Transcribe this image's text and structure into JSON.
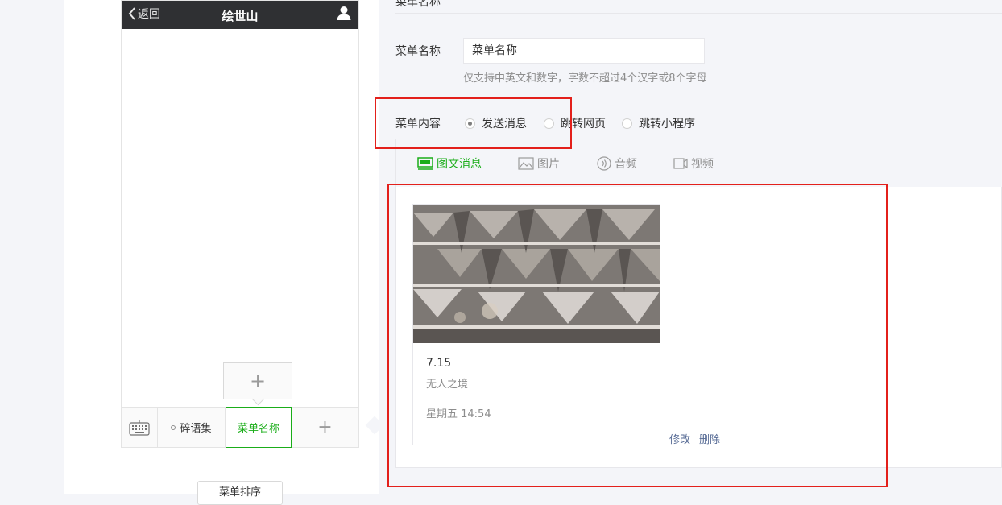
{
  "phone": {
    "back_label": "返回",
    "title": "绘世山",
    "submenu_add": "+",
    "menu": [
      {
        "label": "碎语集"
      },
      {
        "label": "菜单名称"
      },
      {
        "label": "+"
      }
    ]
  },
  "sort_button": "菜单排序",
  "editor": {
    "title": "菜单名称",
    "name_label": "菜单名称",
    "name_value": "菜单名称",
    "name_tip": "仅支持中英文和数字，字数不超过4个汉字或8个字母",
    "content_label": "菜单内容",
    "radios": [
      {
        "label": "发送消息",
        "checked": true
      },
      {
        "label": "跳转网页",
        "checked": false
      },
      {
        "label": "跳转小程序",
        "checked": false
      }
    ],
    "tabs": [
      {
        "label": "图文消息",
        "icon": "news-icon",
        "active": true
      },
      {
        "label": "图片",
        "icon": "image-icon",
        "active": false
      },
      {
        "label": "音频",
        "icon": "audio-icon",
        "active": false
      },
      {
        "label": "视频",
        "icon": "video-icon",
        "active": false
      }
    ],
    "article": {
      "title": "7.15",
      "desc": "无人之境",
      "date": "星期五 14:54"
    },
    "actions": {
      "edit": "修改",
      "delete": "删除"
    }
  },
  "colors": {
    "accent": "#1aad19",
    "highlight": "#e3201b",
    "header": "#2f3033",
    "link": "#576b95"
  }
}
